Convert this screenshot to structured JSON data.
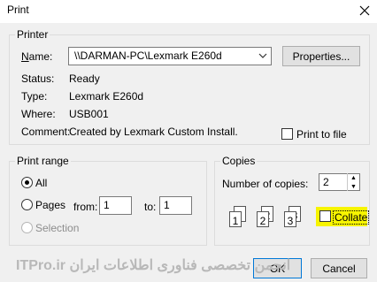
{
  "window": {
    "title": "Print"
  },
  "printer": {
    "group_label": "Printer",
    "name_label": "Name:",
    "name_value": "\\\\DARMAN-PC\\Lexmark E260d",
    "properties_label": "Properties...",
    "status_label": "Status:",
    "status_value": "Ready",
    "type_label": "Type:",
    "type_value": "Lexmark E260d",
    "where_label": "Where:",
    "where_value": "USB001",
    "comment_label": "Comment:",
    "comment_value": "Created by Lexmark Custom Install.",
    "print_to_file_label": "Print to file",
    "print_to_file_checked": false
  },
  "print_range": {
    "group_label": "Print range",
    "all_label": "All",
    "pages_label": "Pages",
    "from_label": "from:",
    "from_value": "1",
    "to_label": "to:",
    "to_value": "1",
    "selection_label": "Selection",
    "selected": "All"
  },
  "copies": {
    "group_label": "Copies",
    "number_label": "Number of copies:",
    "number_value": "2",
    "collate_label": "Collate",
    "collate_checked": false,
    "collate_highlight_color": "#f7f400"
  },
  "buttons": {
    "ok_label": "OK",
    "cancel_label": "Cancel"
  },
  "watermark": {
    "text": "انجمن تخصصی فناوری اطلاعات ایران ITPro.ir"
  }
}
